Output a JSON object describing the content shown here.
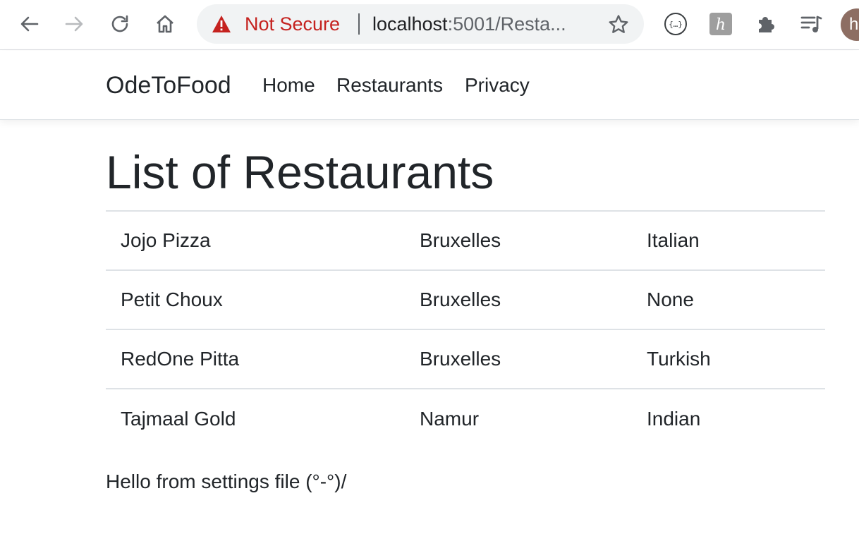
{
  "browser": {
    "security_label": "Not Secure",
    "url_host": "localhost",
    "url_path": ":5001/Resta...",
    "avatar_initial": "h",
    "icons": [
      "back-arrow-icon",
      "forward-arrow-icon",
      "reload-icon",
      "home-icon",
      "warning-triangle-icon",
      "star-icon",
      "json-viewer-extension-icon",
      "honey-extension-icon",
      "puzzle-extensions-icon",
      "media-playlist-icon"
    ],
    "colors": {
      "warning": "#c5221f",
      "omnibox_bg": "#f1f3f4",
      "avatar_bg": "#8d6e63"
    }
  },
  "navbar": {
    "brand": "OdeToFood",
    "links": [
      "Home",
      "Restaurants",
      "Privacy"
    ]
  },
  "main": {
    "title": "List of Restaurants",
    "restaurants": [
      {
        "name": "Jojo Pizza",
        "location": "Bruxelles",
        "cuisine": "Italian"
      },
      {
        "name": "Petit Choux",
        "location": "Bruxelles",
        "cuisine": "None"
      },
      {
        "name": "RedOne Pitta",
        "location": "Bruxelles",
        "cuisine": "Turkish"
      },
      {
        "name": "Tajmaal Gold",
        "location": "Namur",
        "cuisine": "Indian"
      }
    ],
    "settings_message": "Hello from settings file (°-°)/"
  }
}
